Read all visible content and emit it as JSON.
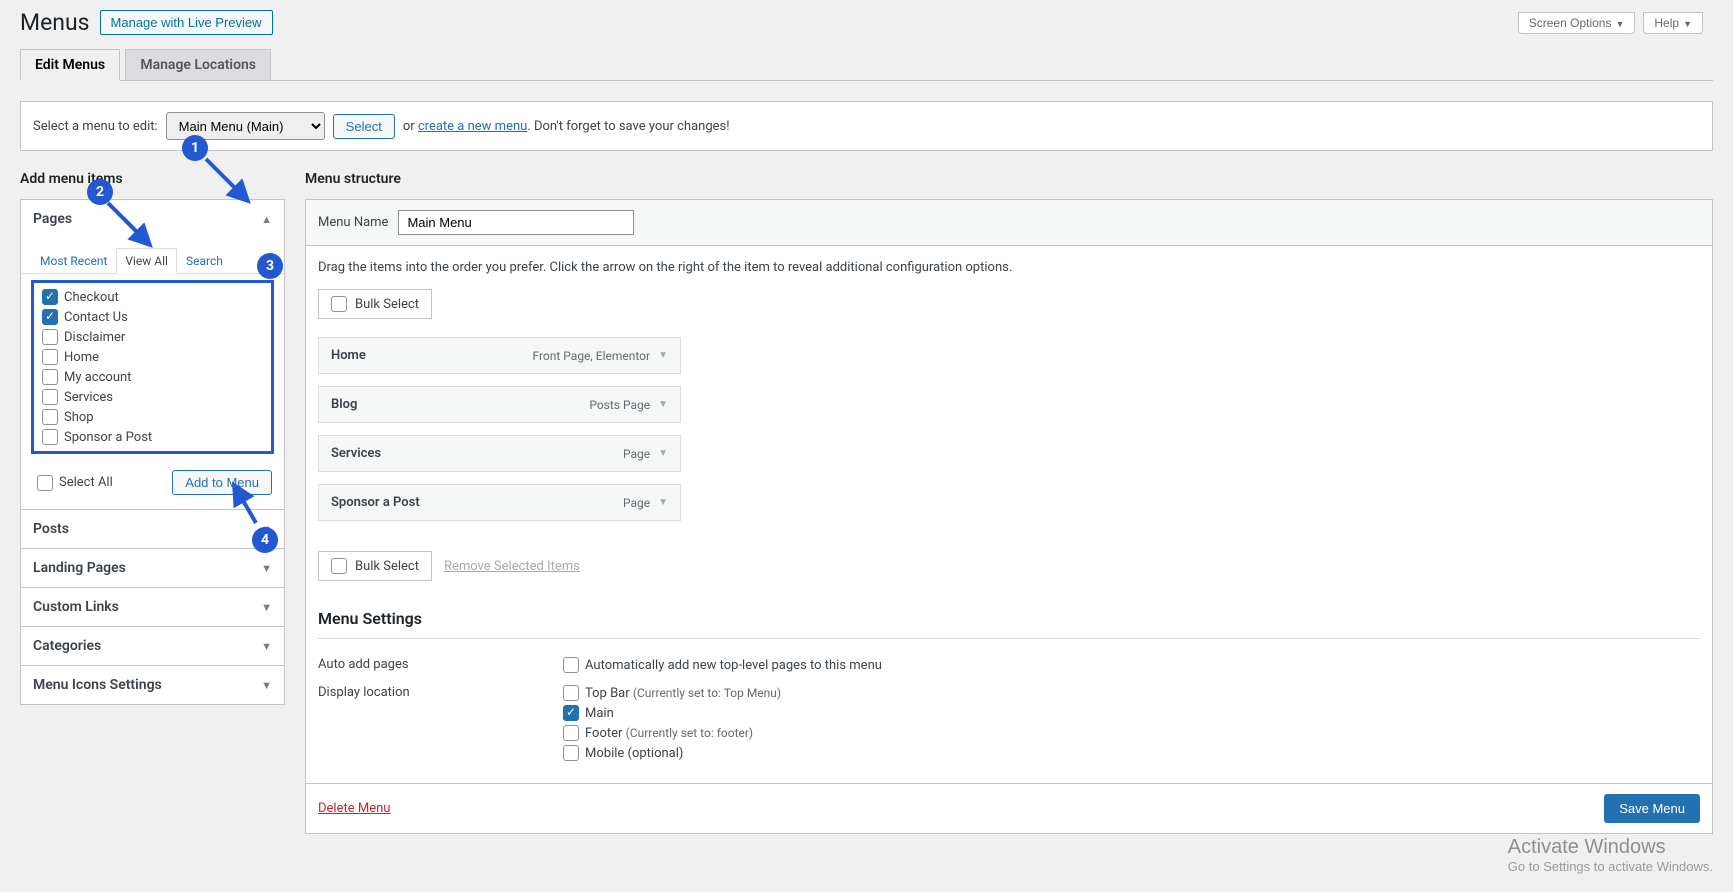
{
  "header": {
    "title": "Menus",
    "live_preview": "Manage with Live Preview",
    "screen_options": "Screen Options",
    "help": "Help"
  },
  "tabs": {
    "edit": "Edit Menus",
    "locations": "Manage Locations"
  },
  "select_bar": {
    "label": "Select a menu to edit:",
    "option": "Main Menu (Main)",
    "select_btn": "Select",
    "or": "or",
    "create_link": "create a new menu",
    "reminder": ". Don't forget to save your changes!"
  },
  "left": {
    "heading": "Add menu items",
    "pages": {
      "title": "Pages",
      "tab_recent": "Most Recent",
      "tab_all": "View All",
      "tab_search": "Search",
      "items": [
        {
          "label": "Checkout",
          "checked": true
        },
        {
          "label": "Contact Us",
          "checked": true
        },
        {
          "label": "Disclaimer",
          "checked": false
        },
        {
          "label": "Home",
          "checked": false
        },
        {
          "label": "My account",
          "checked": false
        },
        {
          "label": "Services",
          "checked": false
        },
        {
          "label": "Shop",
          "checked": false
        },
        {
          "label": "Sponsor a Post",
          "checked": false
        }
      ],
      "select_all": "Select All",
      "add_btn": "Add to Menu"
    },
    "panels": {
      "posts": "Posts",
      "landing": "Landing Pages",
      "custom": "Custom Links",
      "categories": "Categories",
      "icons": "Menu Icons Settings"
    }
  },
  "right": {
    "heading": "Menu structure",
    "name_label": "Menu Name",
    "name_value": "Main Menu",
    "hint": "Drag the items into the order you prefer. Click the arrow on the right of the item to reveal additional configuration options.",
    "bulk": "Bulk Select",
    "remove_selected": "Remove Selected Items",
    "items": [
      {
        "label": "Home",
        "type": "Front Page, Elementor"
      },
      {
        "label": "Blog",
        "type": "Posts Page"
      },
      {
        "label": "Services",
        "type": "Page"
      },
      {
        "label": "Sponsor a Post",
        "type": "Page"
      }
    ],
    "settings": {
      "heading": "Menu Settings",
      "auto_label": "Auto add pages",
      "auto_text": "Automatically add new top-level pages to this menu",
      "loc_label": "Display location",
      "top_bar": "Top Bar",
      "top_bar_sub": "(Currently set to: Top Menu)",
      "main": "Main",
      "footer": "Footer",
      "footer_sub": "(Currently set to: footer)",
      "mobile": "Mobile (optional)"
    },
    "delete": "Delete Menu",
    "save": "Save Menu"
  },
  "badges": {
    "b1": "1",
    "b2": "2",
    "b3": "3",
    "b4": "4"
  },
  "watermark": {
    "title": "Activate Windows",
    "sub": "Go to Settings to activate Windows."
  }
}
